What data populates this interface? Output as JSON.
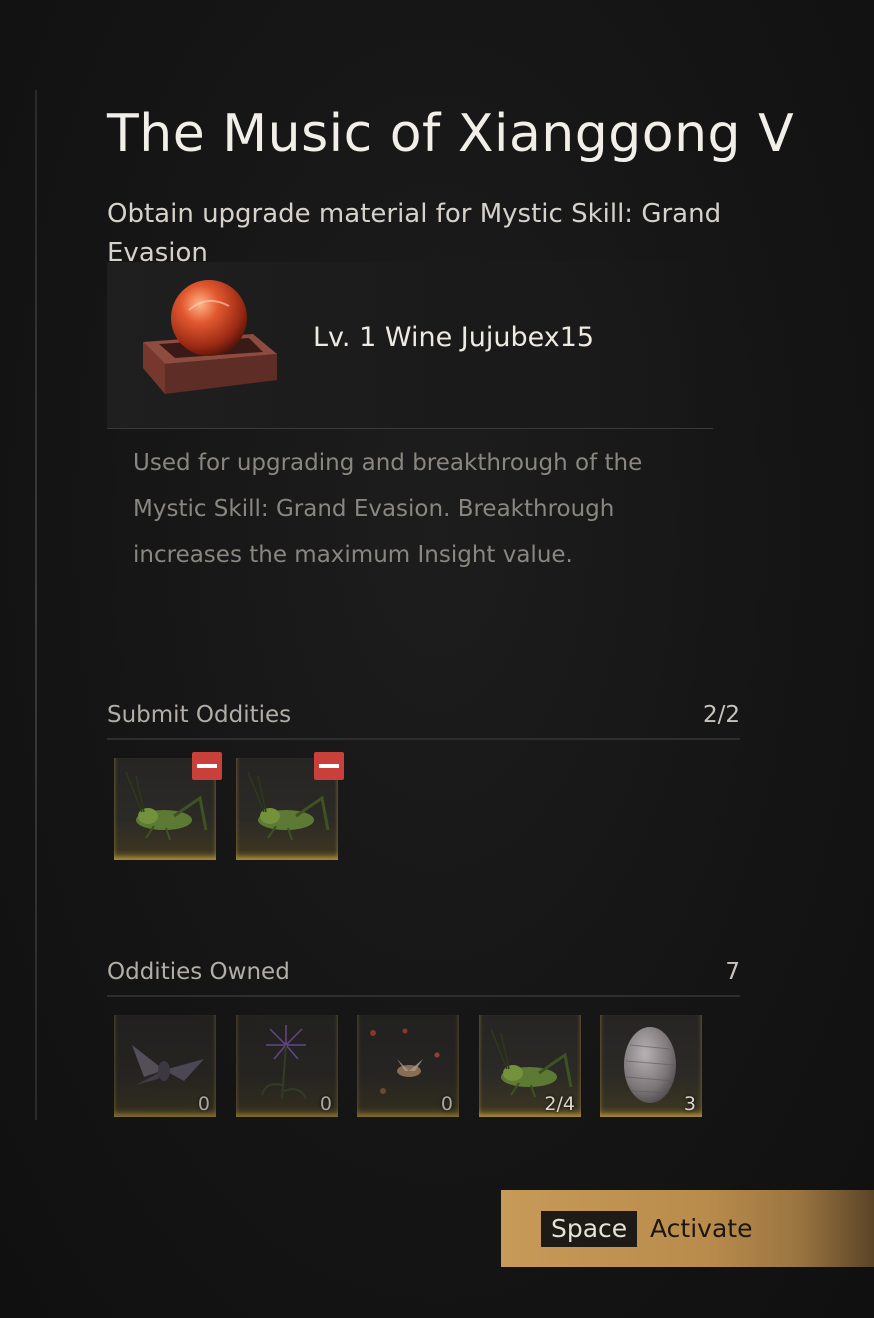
{
  "quest": {
    "title": "The Music of Xianggong V",
    "subtitle": "Obtain upgrade material for Mystic Skill: Grand Evasion"
  },
  "reward": {
    "icon": "red-orb-on-stand-icon",
    "name": "Lv. 1 Wine Jujubex15",
    "description": "Used for upgrading and breakthrough of the Mystic Skill: Grand Evasion. Breakthrough increases the maximum Insight value."
  },
  "submit": {
    "label": "Submit Oddities",
    "count": "2/2",
    "slots": [
      {
        "icon": "cricket-icon"
      },
      {
        "icon": "cricket-icon"
      }
    ]
  },
  "owned": {
    "label": "Oddities Owned",
    "count": "7",
    "items": [
      {
        "icon": "moth-icon",
        "count": "0"
      },
      {
        "icon": "purple-flower-icon",
        "count": "0"
      },
      {
        "icon": "fireflies-icon",
        "count": "0"
      },
      {
        "icon": "cricket-icon",
        "count": "2/4"
      },
      {
        "icon": "stone-egg-icon",
        "count": "3"
      }
    ]
  },
  "action": {
    "key": "Space",
    "label": "Activate"
  },
  "colors": {
    "accent_gold": "#c79a58",
    "remove_red": "#c9403a",
    "background": "#141414"
  }
}
